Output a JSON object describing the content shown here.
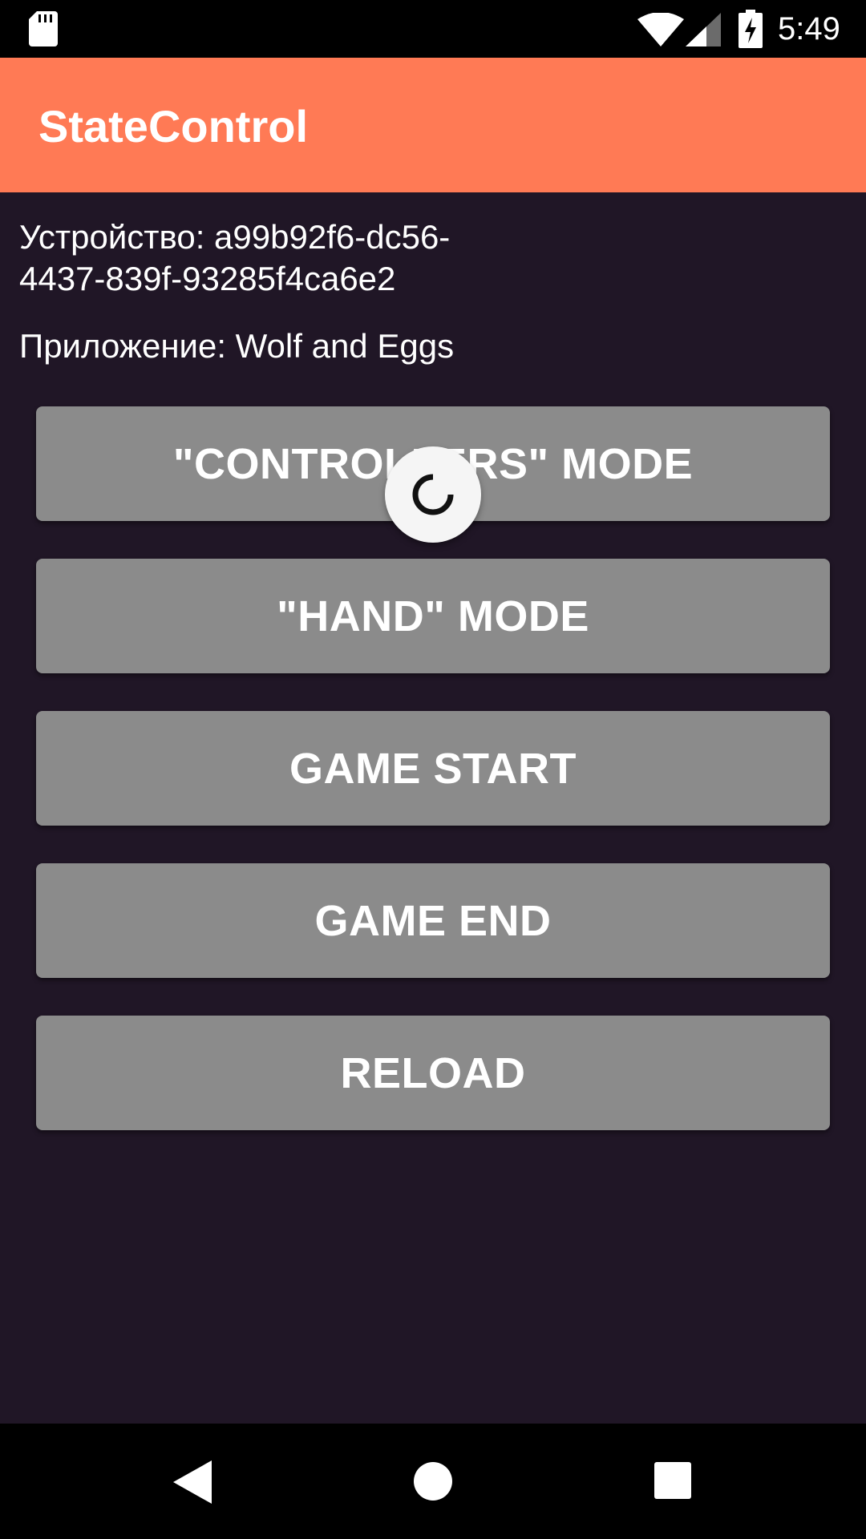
{
  "status_bar": {
    "time": "5:49",
    "icons": [
      "sd-card-icon",
      "wifi-icon",
      "signal-icon",
      "battery-charging-icon"
    ]
  },
  "app_bar": {
    "title": "StateControl",
    "color": "#ff7a55"
  },
  "info": {
    "device": "Устройство: a99b92f6-dc56-4437-839f-93285f4ca6e2",
    "application": "Приложение: Wolf and Eggs"
  },
  "buttons": [
    {
      "label": "\"CONTROLLERS\" MODE"
    },
    {
      "label": "\"HAND\" MODE"
    },
    {
      "label": "GAME START"
    },
    {
      "label": "GAME END"
    },
    {
      "label": "RELOAD"
    }
  ],
  "loading_indicator": {
    "icon": "refresh-spinner-icon"
  },
  "nav_bar": {
    "icons": [
      "back-icon",
      "home-icon",
      "recents-icon"
    ]
  },
  "colors": {
    "background": "#201626",
    "button": "#8b8b8b",
    "accent": "#ff7a55"
  }
}
